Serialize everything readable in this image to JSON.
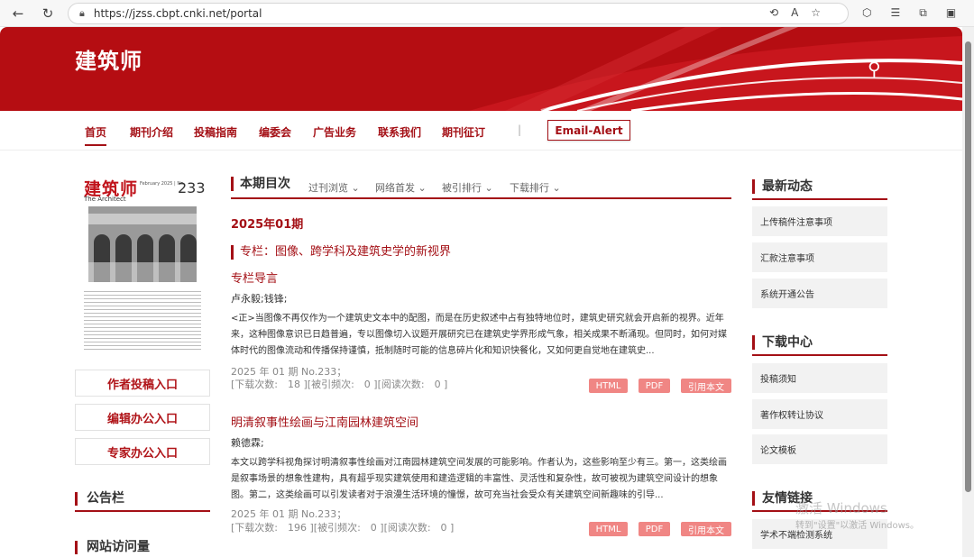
{
  "browser": {
    "url": "https://jzss.cbpt.cnki.net/portal"
  },
  "site": {
    "title": "建筑师"
  },
  "nav": {
    "items": [
      "首页",
      "期刊介绍",
      "投稿指南",
      "编委会",
      "广告业务",
      "联系我们",
      "期刊征订"
    ],
    "separator": "|",
    "email_alert": "Email-Alert"
  },
  "cover": {
    "title": "建筑师",
    "subtitle": "The Architect",
    "date": "February 2025 | No.",
    "issue": "233"
  },
  "left": {
    "entries": [
      "作者投稿入口",
      "编辑办公入口",
      "专家办公入口"
    ],
    "notice_heading": "公告栏",
    "visits_heading": "网站访问量"
  },
  "toc": {
    "heading": "本期目次",
    "tabs": [
      "过刊浏览",
      "网络首发",
      "被引排行",
      "下载排行"
    ],
    "issue": "2025年01期",
    "column": "专栏：图像、跨学科及建筑史学的新视界",
    "articles": [
      {
        "title": "专栏导言",
        "authors": "卢永毅;钱锋;",
        "abstract": "<正>当图像不再仅作为一个建筑史文本中的配图，而是在历史叙述中占有独特地位时，建筑史研究就会开启新的视界。近年来，这种图像意识已日趋普遍，专以图像切入议题开展研究已在建筑史学界形成气象，相关成果不断涌现。但同时，如何对媒体时代的图像流动和传播保持谨慎，抵制随时可能的信息碎片化和知识快餐化，又如何更自觉地在建筑史...",
        "meta": "2025 年 01 期 No.233；",
        "stats": "[下载次数:　18 ][被引频次:　0 ][阅读次数:　0 ]"
      },
      {
        "title": "明清叙事性绘画与江南园林建筑空间",
        "authors": "赖德霖;",
        "abstract": "本文以跨学科视角探讨明清叙事性绘画对江南园林建筑空间发展的可能影响。作者认为，这些影响至少有三。第一，这类绘画是叙事场景的想象性建构，具有超乎现实建筑使用和建造逻辑的丰富性、灵活性和复杂性，故可被视为建筑空间设计的想象图。第二，这类绘画可以引发读者对于浪漫生活环境的憧憬，故可充当社会受众有关建筑空间新趣味的引导...",
        "meta": "2025 年 01 期 No.233；",
        "stats": "[下载次数:　196 ][被引频次:　0 ][阅读次数:　0 ]"
      }
    ],
    "buttons": [
      "HTML",
      "PDF",
      "引用本文"
    ]
  },
  "right": {
    "news_heading": "最新动态",
    "news": [
      "上传稿件注意事项",
      "汇款注意事项",
      "系统开通公告"
    ],
    "download_heading": "下载中心",
    "downloads": [
      "投稿须知",
      "著作权转让协议",
      "论文模板"
    ],
    "links_heading": "友情链接",
    "links": [
      "学术不端检测系统"
    ]
  },
  "watermark": {
    "line1": "激活 Windows",
    "line2": "转到\"设置\"以激活 Windows。"
  },
  "colors": {
    "brand": "#a41016",
    "banner": "#b50d12",
    "button": "#f08684"
  }
}
